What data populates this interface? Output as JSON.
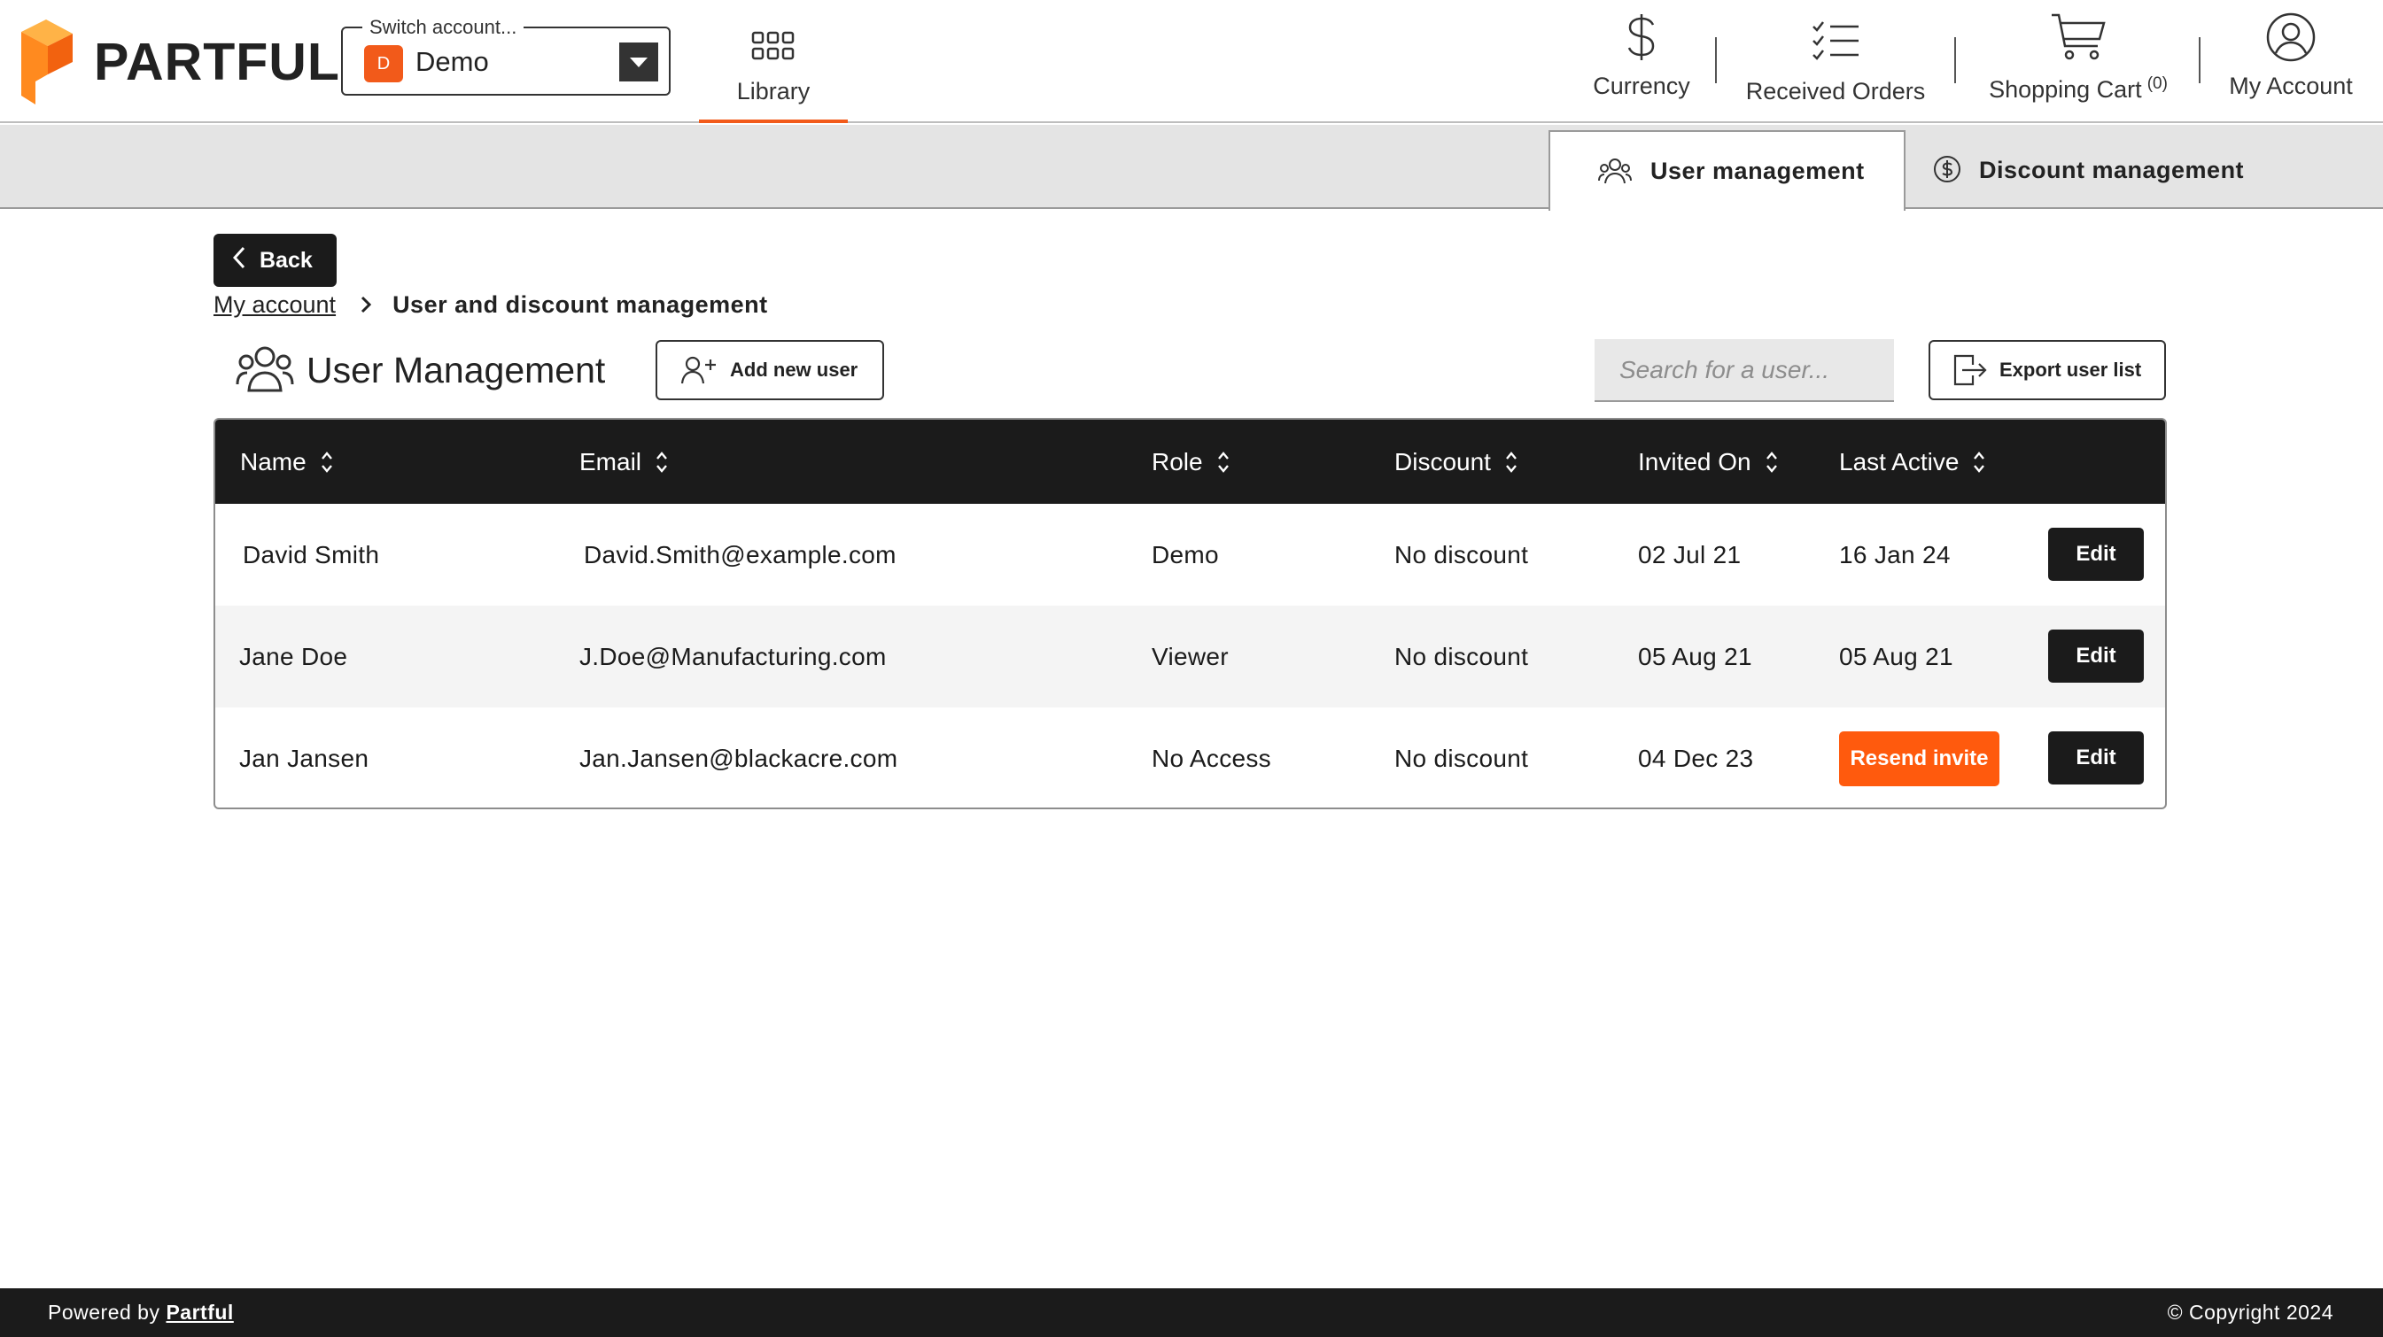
{
  "brand": {
    "name": "PARTFUL",
    "accent": "#f25a1a",
    "dark": "#1b1b1b"
  },
  "account_switcher": {
    "label": "Switch account...",
    "badge": "D",
    "value": "Demo"
  },
  "nav": {
    "library": "Library",
    "currency": "Currency",
    "received_orders": "Received Orders",
    "shopping_cart": "Shopping Cart",
    "cart_count": "(0)",
    "my_account": "My Account"
  },
  "tabs": {
    "user_management": "User management",
    "discount_management": "Discount management"
  },
  "back_label": "Back",
  "breadcrumb": {
    "parent": "My account",
    "current": "User and discount management"
  },
  "page_title": "User Management",
  "add_user_label": "Add new user",
  "search_placeholder": "Search for a user...",
  "export_label": "Export user list",
  "table": {
    "headers": [
      "Name",
      "Email",
      "Role",
      "Discount",
      "Invited On",
      "Last Active"
    ],
    "rows": [
      {
        "name": "David Smith",
        "email": "David.Smith@example.com",
        "role": "Demo",
        "discount": "No discount",
        "invited": "02 Jul 21",
        "last_active": "16 Jan 24",
        "action": "Edit"
      },
      {
        "name": "Jane Doe",
        "email": "J.Doe@Manufacturing.com",
        "role": "Viewer",
        "discount": "No discount",
        "invited": "05 Aug 21",
        "last_active": "05 Aug 21",
        "action": "Edit"
      },
      {
        "name": "Jan Jansen",
        "email": "Jan.Jansen@blackacre.com",
        "role": "No Access",
        "discount": "No discount",
        "invited": "04 Dec 23",
        "last_active_action": "Resend invite",
        "action": "Edit"
      }
    ]
  },
  "footer": {
    "powered_by": "Powered by",
    "powered_link": "Partful",
    "copyright": "© Copyright 2024"
  }
}
